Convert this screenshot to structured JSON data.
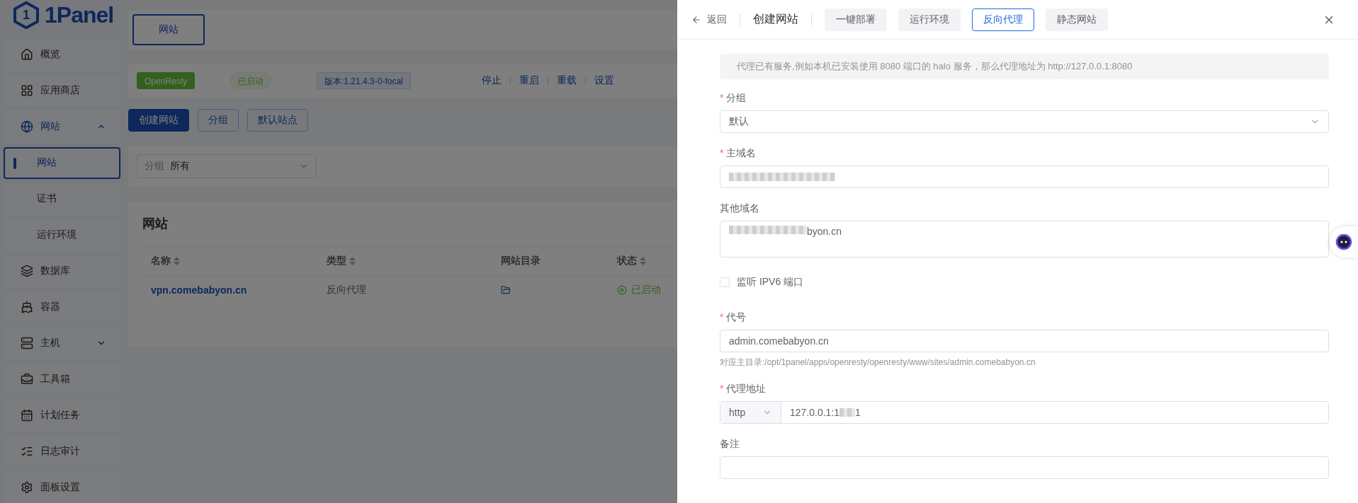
{
  "sidebar": {
    "logo": {
      "mark": "1",
      "name": "1Panel"
    },
    "items": [
      {
        "label": "概览",
        "selected": false
      },
      {
        "label": "应用商店",
        "selected": false
      },
      {
        "label": "网站",
        "selected": false,
        "expanded": true,
        "children": [
          {
            "label": "网站",
            "selected": true
          },
          {
            "label": "证书",
            "selected": false
          },
          {
            "label": "运行环境",
            "selected": false
          }
        ]
      },
      {
        "label": "数据库",
        "selected": false
      },
      {
        "label": "容器",
        "selected": false
      },
      {
        "label": "主机",
        "selected": false,
        "expanded": false
      },
      {
        "label": "工具箱",
        "selected": false
      },
      {
        "label": "计划任务",
        "selected": false
      },
      {
        "label": "日志审计",
        "selected": false
      },
      {
        "label": "面板设置",
        "selected": false
      }
    ]
  },
  "tabs": [
    {
      "label": "网站",
      "selected": true
    }
  ],
  "app_status": {
    "app": "OpenResty",
    "state": "已启动",
    "version": "版本:1.21.4.3-0-focal",
    "actions": [
      "停止",
      "重启",
      "重载",
      "设置"
    ]
  },
  "buttons": [
    {
      "label": "创建网站",
      "kind": "primary"
    },
    {
      "label": "分组",
      "kind": "plain"
    },
    {
      "label": "默认站点",
      "kind": "plain"
    }
  ],
  "filter": {
    "label": "分组",
    "value": "所有"
  },
  "table": {
    "title": "网站",
    "columns": [
      {
        "label": "名称",
        "sortable": true
      },
      {
        "label": "类型",
        "sortable": true
      },
      {
        "label": "网站目录",
        "sortable": false
      },
      {
        "label": "状态",
        "sortable": true
      }
    ],
    "rows": [
      {
        "name": "vpn.comebabyon.cn",
        "type": "反向代理",
        "status": "已启动"
      }
    ]
  },
  "drawer": {
    "back": "返回",
    "title": "创建网站",
    "tabs": [
      {
        "label": "一键部署",
        "selected": false
      },
      {
        "label": "运行环境",
        "selected": false
      },
      {
        "label": "反向代理",
        "selected": true
      },
      {
        "label": "静态网站",
        "selected": false
      }
    ],
    "alert": "代理已有服务,例如本机已安装使用 8080 端口的 halo 服务，那么代理地址为 http://127.0.0.1:8080",
    "fields": [
      {
        "kind": "select",
        "label": "分组",
        "required_mark": "*",
        "value": "默认"
      },
      {
        "kind": "input",
        "label": "主域名",
        "required_mark": "*",
        "blurred": true
      },
      {
        "kind": "textarea",
        "label": "其他域名",
        "value": "byon.cn",
        "blurred": true
      },
      {
        "kind": "checkbox",
        "label": "监听 IPV6 端口",
        "checked": false
      },
      {
        "kind": "input",
        "label": "代号",
        "required_mark": "*",
        "value": "admin.comebabyon.cn",
        "hint": "对应主目录:/opt/1panel/apps/openresty/openresty/www/sites/admin.comebabyon.cn"
      },
      {
        "kind": "proxy",
        "label": "代理地址",
        "required_mark": "*",
        "protocol": "http",
        "value": "127.0.0.1:1",
        "suffix": "1",
        "blurred": true
      },
      {
        "kind": "input",
        "label": "备注"
      }
    ]
  }
}
